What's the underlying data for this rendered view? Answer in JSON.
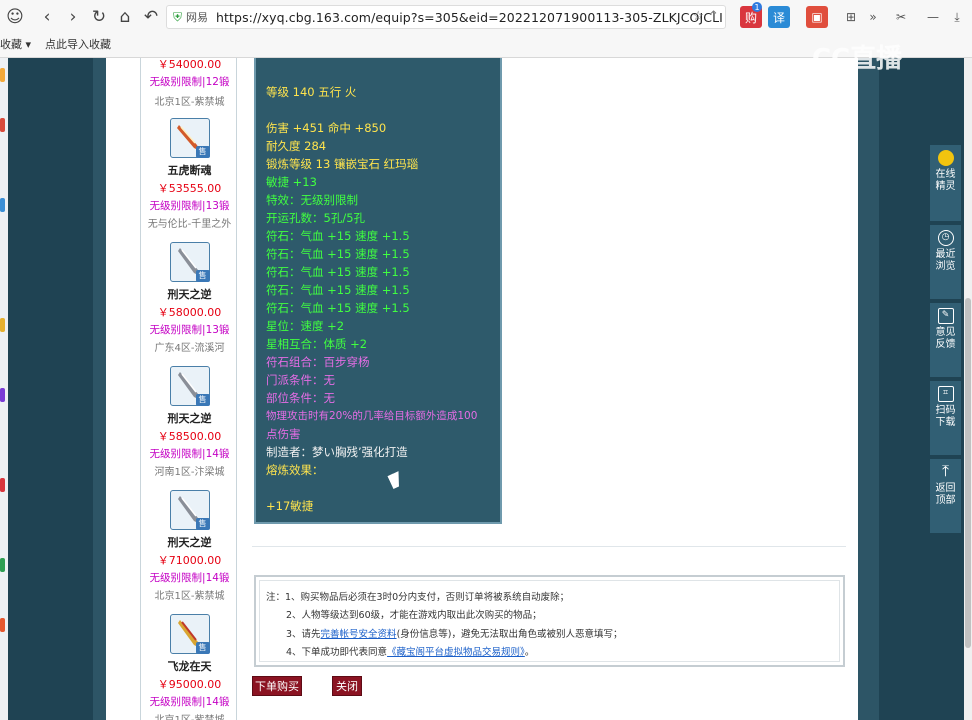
{
  "browser": {
    "url_site": "网易",
    "url": "https://xyq.cbg.163.com/equip?s=305&eid=202212071900113-305-ZLKJCOJCLI",
    "bookmarks": [
      "收藏 ▾",
      "点此导入收藏"
    ],
    "ext_labels": [
      "购",
      "译"
    ],
    "ext_badge": "1"
  },
  "watermark": "CC直播",
  "items": [
    {
      "name": "",
      "price": "￥54000.00",
      "limit": "无级别限制|12锻",
      "server": "北京1区-紫禁城"
    },
    {
      "name": "五虎断魂",
      "price": "￥53555.00",
      "limit": "无级别限制|13锻",
      "server": "无与伦比-千里之外"
    },
    {
      "name": "刑天之逆",
      "price": "￥58000.00",
      "limit": "无级别限制|13锻",
      "server": "广东4区-流溪河"
    },
    {
      "name": "刑天之逆",
      "price": "￥58500.00",
      "limit": "无级别限制|14锻",
      "server": "河南1区-汴梁城"
    },
    {
      "name": "刑天之逆",
      "price": "￥71000.00",
      "limit": "无级别限制|14锻",
      "server": "北京1区-紫禁城"
    },
    {
      "name": "飞龙在天",
      "price": "￥95000.00",
      "limit": "无级别限制|14锻",
      "server": "北京1区-紫禁城"
    }
  ],
  "sell_tag": "售",
  "detail": {
    "level_line": "等级 140 五行 火",
    "damage": "伤害 +451 命中 +850",
    "durability": "耐久度 284",
    "forge": "锻炼等级 13 镶嵌宝石 红玛瑙",
    "agility": "敏捷 +13",
    "special": "特效：无级别限制",
    "slots": "开运孔数：5孔/5孔",
    "rune1": "符石：气血 +15 速度 +1.5",
    "rune2": "符石：气血 +15 速度 +1.5",
    "rune3": "符石：气血 +15 速度 +1.5",
    "rune4": "符石：气血 +15 速度 +1.5",
    "rune5": "符石：气血 +15 速度 +1.5",
    "star": "星位：速度 +2",
    "star_match": "星相互合：体质 +2",
    "combo": "符石组合：百步穿杨",
    "sect": "门派条件：无",
    "part": "部位条件：无",
    "effect_a": "物理攻击时有20%的几率给目标额外造成100",
    "effect_b": "点伤害",
    "maker": "制造者：梦い胸残’强化打造",
    "refine": "熔炼效果：",
    "refine_val": "+17敏捷"
  },
  "notice": {
    "l1": "注：1、购买物品后必须在3时0分内支付，否则订单将被系统自动废除；",
    "l2": "2、人物等级达到60级，才能在游戏内取出此次购买的物品；",
    "l3a": "3、请先",
    "l3link": "完善帐号安全资料",
    "l3b": "(身份信息等)，避免无法取出角色或被别人恶意填写；",
    "l4a": "4、下单成功即代表同意",
    "l4link": "《藏宝阁平台虚拟物品交易规则》",
    "l4b": "。"
  },
  "buttons": {
    "buy": "下单购买",
    "close": "关闭"
  },
  "side_panel": [
    {
      "label1": "在线",
      "label2": "精灵"
    },
    {
      "label1": "最近",
      "label2": "浏览"
    },
    {
      "label1": "意见",
      "label2": "反馈"
    },
    {
      "label1": "扫码",
      "label2": "下载"
    },
    {
      "label1": "返回",
      "label2": "顶部"
    }
  ]
}
